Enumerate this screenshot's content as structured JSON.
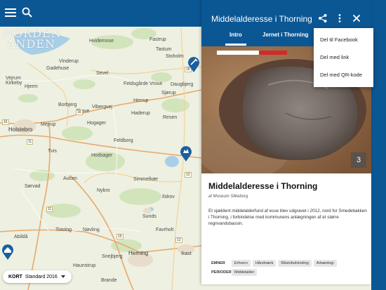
{
  "app": {
    "logo_line1": "NORDEN",
    "logo_line2": "ANDEN"
  },
  "map": {
    "places": [
      "Hvidemose",
      "Fastrup",
      "Tastum",
      "Stoholm",
      "Vinderup",
      "Gadehuse",
      "Sevel",
      "Vejrum",
      "Kirkeby",
      "Hjerm",
      "Feldsgårde Vroue",
      "Daugbjerg",
      "Sjørup",
      "Borbjerg",
      "Skave",
      "Vibergvej",
      "Herrup",
      "Haderup",
      "Resen",
      "Holstebro",
      "Mejrup",
      "Hogager",
      "Feldborg",
      "Tvis",
      "Hodsager",
      "Sørvad",
      "Simmelkær",
      "Aulum",
      "Nybro",
      "Ilskov",
      "Sunds",
      "Timring",
      "Nøvling",
      "Favrholt",
      "Abildå",
      "Snejbjerg",
      "Herning",
      "Ikast",
      "Haunstrup",
      "Brande"
    ],
    "road_numbers": [
      "16",
      "11",
      "12",
      "16",
      "18",
      "11",
      "12",
      "15"
    ]
  },
  "kort_control": {
    "label": "KORT",
    "layer": "Standard 2016"
  },
  "panel": {
    "title": "Middelalderesse i Thorning",
    "tabs": [
      "Intro",
      "Jernet i Thorning"
    ],
    "photo_count": "3",
    "item_title": "Middelalderesse i Thorning",
    "museum": "af Museum Silkeborg",
    "description": "Et sjældent middelalderfund af esse blev udgravet i 2012, nord for Smedebakken i Thorning, i forbindelse med kommunens anlægningen af et større regnvandsbassin.",
    "tag_groups": [
      {
        "label": "EMNER",
        "tags": [
          "Erhverv",
          "Håndværk",
          "Råstofudvinding",
          "Arkæologi"
        ]
      },
      {
        "label": "PERIODER",
        "tags": [
          "Middelalder"
        ]
      }
    ]
  },
  "share_menu": {
    "items": [
      "Del til Facebook",
      "Del med link",
      "Del med QR-kode"
    ]
  },
  "colors": {
    "primary": "#0b5794",
    "marker": "#1a5f9e"
  }
}
